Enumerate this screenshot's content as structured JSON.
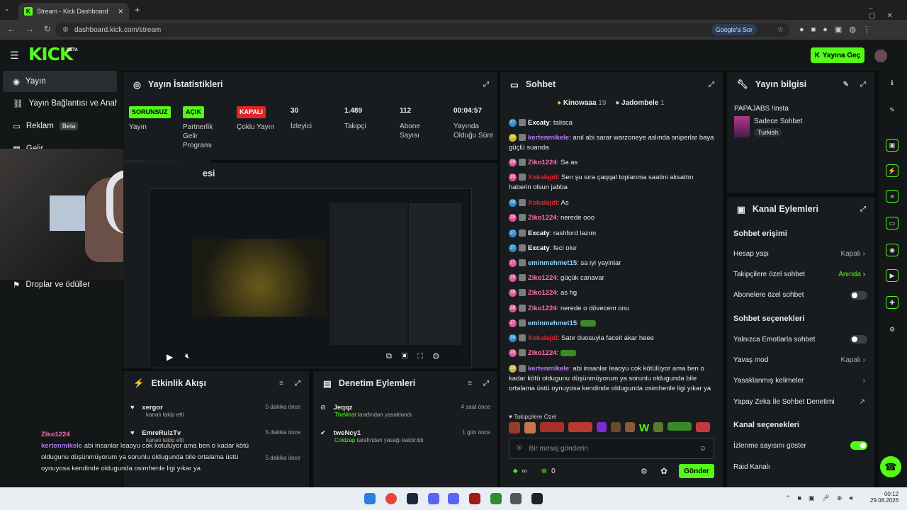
{
  "browser": {
    "tab_title": "Stream - Kick Dashboard",
    "url": "dashboard.kick.com/stream",
    "google_ask": "Google'a Sor"
  },
  "app": {
    "logo": "KICK",
    "logo_beta": "BETA",
    "go_live": "Yayına Geç"
  },
  "sidebar": {
    "items": [
      {
        "label": "Yayın",
        "icon": "broadcast-icon"
      },
      {
        "label": "Yayın Bağlantısı ve Anahtarı",
        "icon": "link-icon"
      },
      {
        "label": "Reklam",
        "icon": "ad-icon",
        "badge": "Beta"
      },
      {
        "label": "Gelir",
        "icon": "revenue-icon"
      },
      {
        "label": "Droplar ve ödüller",
        "icon": "gift-icon"
      }
    ]
  },
  "stats": {
    "title": "Yayın İstatistikleri",
    "cols": [
      {
        "tag": "SORUNSUZ",
        "tag_color": "#53fc18",
        "label": "Yayın"
      },
      {
        "tag": "AÇIK",
        "tag_color": "#53fc18",
        "label": "Partnerlik Gelir Programı"
      },
      {
        "tag": "KAPALI",
        "tag_color": "#e0262b",
        "label": "Çoklu Yayın"
      },
      {
        "value": "30",
        "label": "İzleyici"
      },
      {
        "value": "1.489",
        "label": "Takipçi"
      },
      {
        "value": "112",
        "label": "Abone Sayısı"
      },
      {
        "value": "00:04:57",
        "label": "Yayında Olduğu Süre"
      }
    ]
  },
  "preview": {
    "title_fragment": "esi"
  },
  "activity": {
    "title": "Etkinlik Akışı",
    "items": [
      {
        "user": "xergor",
        "text": "kanalı takip etti",
        "time": "5 dakika önce"
      },
      {
        "user": "EmreRulzTv",
        "text": "kanalı takip etti",
        "time": "5 dakika önce"
      },
      {
        "user": "",
        "text": "",
        "time": "5 dakika önce"
      }
    ]
  },
  "moderation": {
    "title": "Denetim Eylemleri",
    "items": [
      {
        "user": "Jeqqz",
        "actor": "TheWrat",
        "text": "tarafından yasaklandı",
        "time": "4 saat önce"
      },
      {
        "user": "tweNcy1",
        "actor": "Coldzap",
        "text": "tarafından yasağı kaldırıldı",
        "time": "1 gün önce"
      }
    ]
  },
  "overlay_chat": {
    "line1_user": "Ziko1224",
    "line2_user": "kertenmikele",
    "line2_text": "abi insanlar leaoyu cok kotuluyor ama ben o kadar kötü oldugunu düşünmüyorum ya sorunlu oldugunda bile ortalama üstü oynuyosa kendinde oldugunda osimhenle ligi yıkar ya"
  },
  "chat": {
    "title": "Sohbet",
    "top_users": [
      {
        "name": "Kinowaaa",
        "count": "19"
      },
      {
        "name": "Jadombele",
        "count": "1"
      }
    ],
    "messages": [
      {
        "lvl": "37",
        "lvl_color": "#2f8fd0",
        "user": "Excaty",
        "color": "#ffffff",
        "text": "talisca"
      },
      {
        "lvl": "18",
        "lvl_color": "#c9b83a",
        "user": "kertenmikele",
        "color": "#b57bff",
        "text": "anıl abi sarar warzoneye aslında sniperlar baya güçlü suanda"
      },
      {
        "lvl": "28",
        "lvl_color": "#e0579a",
        "user": "Ziko1224",
        "color": "#ff6fb1",
        "text": "Sa as"
      },
      {
        "lvl": "28",
        "lvl_color": "#e0579a",
        "user": "Xokalajdi",
        "color": "#e0262b",
        "text": "Sen şu sıra çaqqal toplanma saatini aksattın haberin olsun jabba"
      },
      {
        "lvl": "38",
        "lvl_color": "#2f8fd0",
        "user": "Xokalajdi",
        "color": "#e0262b",
        "text": "As"
      },
      {
        "lvl": "28",
        "lvl_color": "#e0579a",
        "user": "Ziko1224",
        "color": "#ff6fb1",
        "text": "nerede ooo"
      },
      {
        "lvl": "37",
        "lvl_color": "#2f8fd0",
        "user": "Excaty",
        "color": "#ffffff",
        "text": "rashford lazım"
      },
      {
        "lvl": "37",
        "lvl_color": "#2f8fd0",
        "user": "Excaty",
        "color": "#ffffff",
        "text": "feci olur"
      },
      {
        "lvl": "27",
        "lvl_color": "#e0579a",
        "user": "eminmehmet15",
        "color": "#8fd0ff",
        "text": "sa iyi yayinlar"
      },
      {
        "lvl": "28",
        "lvl_color": "#e0579a",
        "user": "Ziko1224",
        "color": "#ff6fb1",
        "text": "güçük canavar"
      },
      {
        "lvl": "28",
        "lvl_color": "#e0579a",
        "user": "Ziko1224",
        "color": "#ff6fb1",
        "text": "as hg"
      },
      {
        "lvl": "28",
        "lvl_color": "#e0579a",
        "user": "Ziko1224",
        "color": "#ff6fb1",
        "text": "nerede o dövecem onu"
      },
      {
        "lvl": "27",
        "lvl_color": "#e0579a",
        "user": "eminmehmet15",
        "color": "#8fd0ff",
        "text": ""
      },
      {
        "lvl": "38",
        "lvl_color": "#2f8fd0",
        "user": "Xokalajdi",
        "color": "#e0262b",
        "text": "Satır duosuyla faceit akar heee"
      },
      {
        "lvl": "28",
        "lvl_color": "#e0579a",
        "user": "Ziko1224",
        "color": "#ff6fb1",
        "text": ""
      },
      {
        "lvl": "18",
        "lvl_color": "#c9b83a",
        "user": "kertenmikele",
        "color": "#b57bff",
        "text": "abi insanlar leaoyu cok kötülüyor ama ben o kadar kötü oldugunu düşünmüyorum ya sorunlu oldugunda bile ortalama üstü oynuyosa kendinde oldugunda osimhenle ligi yıkar ya"
      }
    ],
    "followers_only": "Takipçilere Özel",
    "input_placeholder": "Bir mesaj gönderin",
    "points": "∞",
    "count": "0",
    "send": "Gönder"
  },
  "stream_info": {
    "title": "Yayın bilgisi",
    "stream_title": "PAPAJABS !insta",
    "category": "Sadece Sohbet",
    "language": "Turkish"
  },
  "channel_actions": {
    "title": "Kanal Eylemleri",
    "section1": "Sohbet erişimi",
    "account_age": "Hesap yaşı",
    "account_age_val": "Kapalı",
    "follower_chat": "Takipçilere özel sohbet",
    "follower_chat_val": "Anında",
    "sub_chat": "Abonelere özel sohbet",
    "section2": "Sohbet seçenekleri",
    "emote_only": "Yalnızca Emotlarla sohbet",
    "slow_mode": "Yavaş mod",
    "slow_mode_val": "Kapalı",
    "banned_words": "Yasaklanmış kelimeler",
    "ai_mod": "Yapay Zeka İle Sohbet Denetimi",
    "section3": "Kanal seçenekleri",
    "show_viewers": "İzlenme sayısını göster",
    "raid": "Raid Kanalı"
  },
  "taskbar": {
    "time": "00:12",
    "date": "29.08.2026"
  }
}
